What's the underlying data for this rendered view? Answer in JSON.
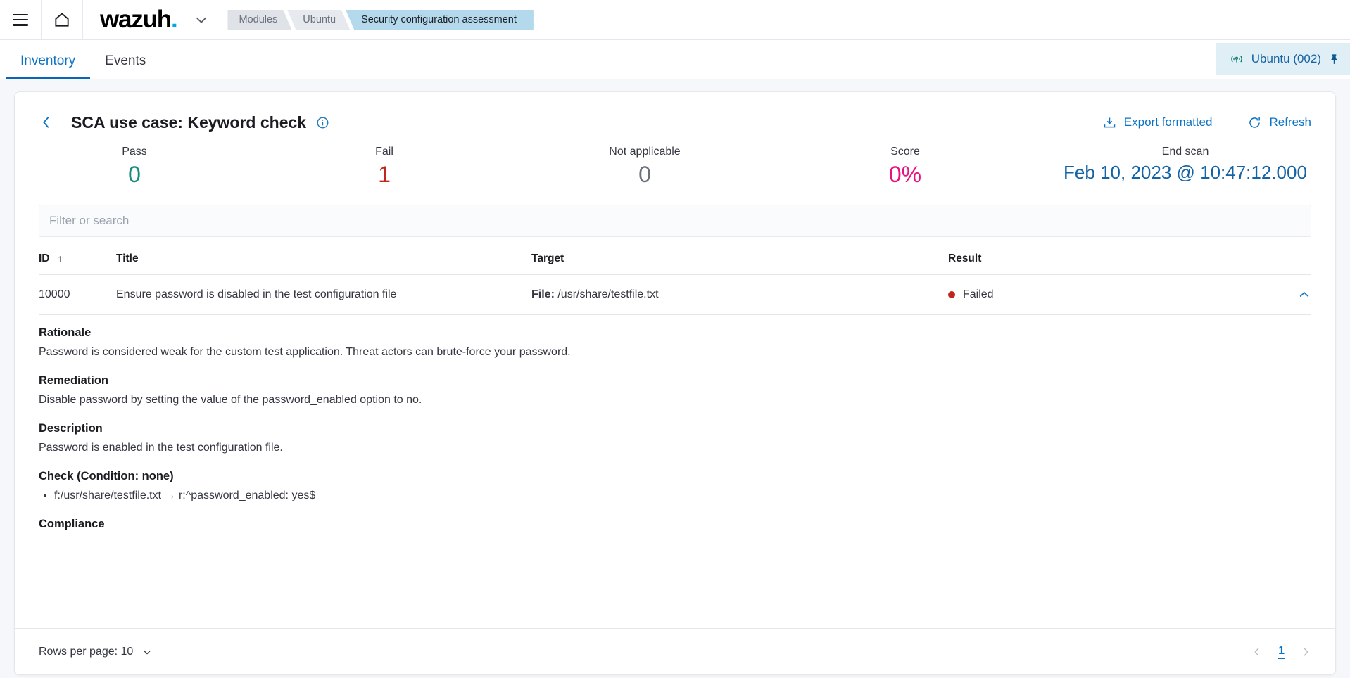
{
  "topnav": {
    "menu_icon": "hamburger-menu-icon",
    "home_icon": "home-icon",
    "logo_text": "wazuh",
    "logo_dot": ".",
    "caret_icon": "chevron-down-icon",
    "breadcrumbs": [
      {
        "label": "Modules"
      },
      {
        "label": "Ubuntu"
      },
      {
        "label": "Security configuration assessment"
      }
    ]
  },
  "tabs": [
    {
      "label": "Inventory",
      "selected": true
    },
    {
      "label": "Events",
      "selected": false
    }
  ],
  "agent": {
    "signal_icon": "signal-icon",
    "label": "Ubuntu (002)",
    "pin_icon": "pin-icon"
  },
  "policy": {
    "back_icon": "chevron-left-icon",
    "title": "SCA use case: Keyword check",
    "info_icon": "info-circle-icon",
    "export_label": "Export formatted",
    "export_icon": "download-icon",
    "refresh_label": "Refresh",
    "refresh_icon": "refresh-icon"
  },
  "stats": [
    {
      "label": "Pass",
      "value": "0",
      "color": "#17897f"
    },
    {
      "label": "Fail",
      "value": "1",
      "color": "#bd271e"
    },
    {
      "label": "Not applicable",
      "value": "0",
      "color": "#6a717d"
    },
    {
      "label": "Score",
      "value": "0%",
      "color": "#e7117f"
    },
    {
      "label": "End scan",
      "value": "Feb 10, 2023 @ 10:47:12.000",
      "color": "#1464a5"
    }
  ],
  "search": {
    "placeholder": "Filter or search",
    "value": ""
  },
  "table": {
    "columns": {
      "id": "ID",
      "id_sort_icon": "sort-ascending-arrow-icon",
      "title": "Title",
      "target": "Target",
      "result": "Result"
    },
    "row": {
      "id": "10000",
      "title": "Ensure password is disabled in the test configuration file",
      "target_label": "File:",
      "target_value": "/usr/share/testfile.txt",
      "result": "Failed",
      "result_color": "#bd271e",
      "expand_icon": "chevron-up-icon"
    }
  },
  "detail": {
    "rationale_heading": "Rationale",
    "rationale_text": "Password is considered weak for the custom test application. Threat actors can brute-force your password.",
    "remediation_heading": "Remediation",
    "remediation_text": "Disable password by setting the value of the password_enabled option to no.",
    "description_heading": "Description",
    "description_text": "Password is enabled in the test configuration file.",
    "check_heading": "Check (Condition: none)",
    "check_items": [
      "f:/usr/share/testfile.txt → r:^password_enabled: yes$"
    ],
    "compliance_heading": "Compliance"
  },
  "footer": {
    "rows_per_page_label": "Rows per page: 10",
    "rows_caret_icon": "chevron-down-icon",
    "prev_icon": "chevron-left-icon",
    "page_number": "1",
    "next_icon": "chevron-right-icon"
  }
}
